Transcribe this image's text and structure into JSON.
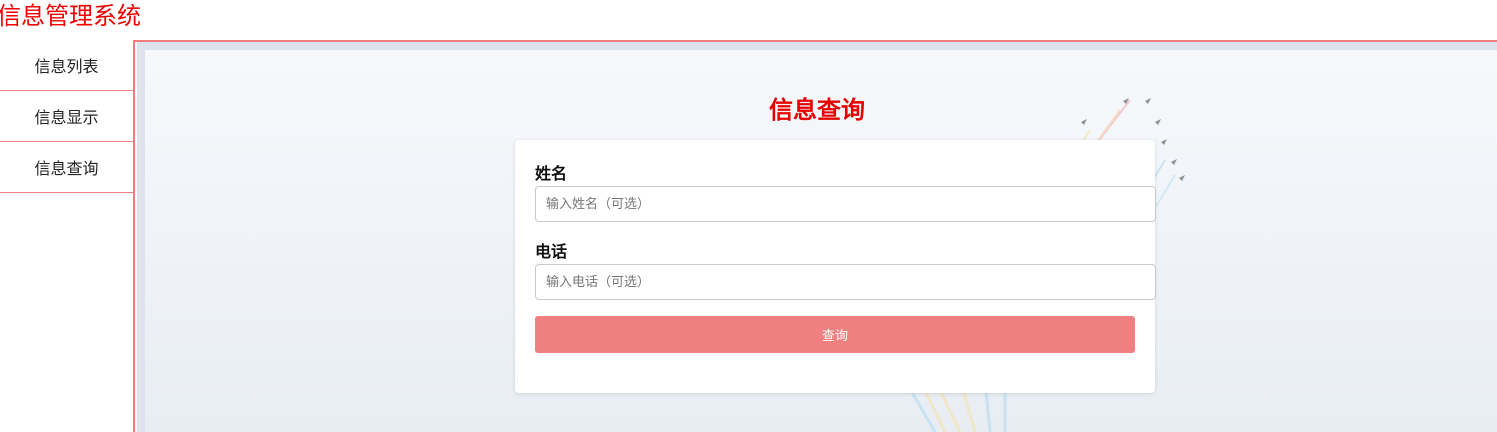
{
  "app": {
    "title": "信息管理系统"
  },
  "sidebar": {
    "items": [
      {
        "label": "信息列表"
      },
      {
        "label": "信息显示"
      },
      {
        "label": "信息查询"
      }
    ]
  },
  "main": {
    "heading": "信息查询",
    "form": {
      "name_label": "姓名",
      "name_placeholder": "输入姓名（可选）",
      "name_value": "",
      "phone_label": "电话",
      "phone_placeholder": "输入电话（可选）",
      "phone_value": "",
      "submit_label": "查询"
    }
  },
  "colors": {
    "accent": "#f00000",
    "border": "#ef7d7d",
    "button": "#f08080"
  }
}
